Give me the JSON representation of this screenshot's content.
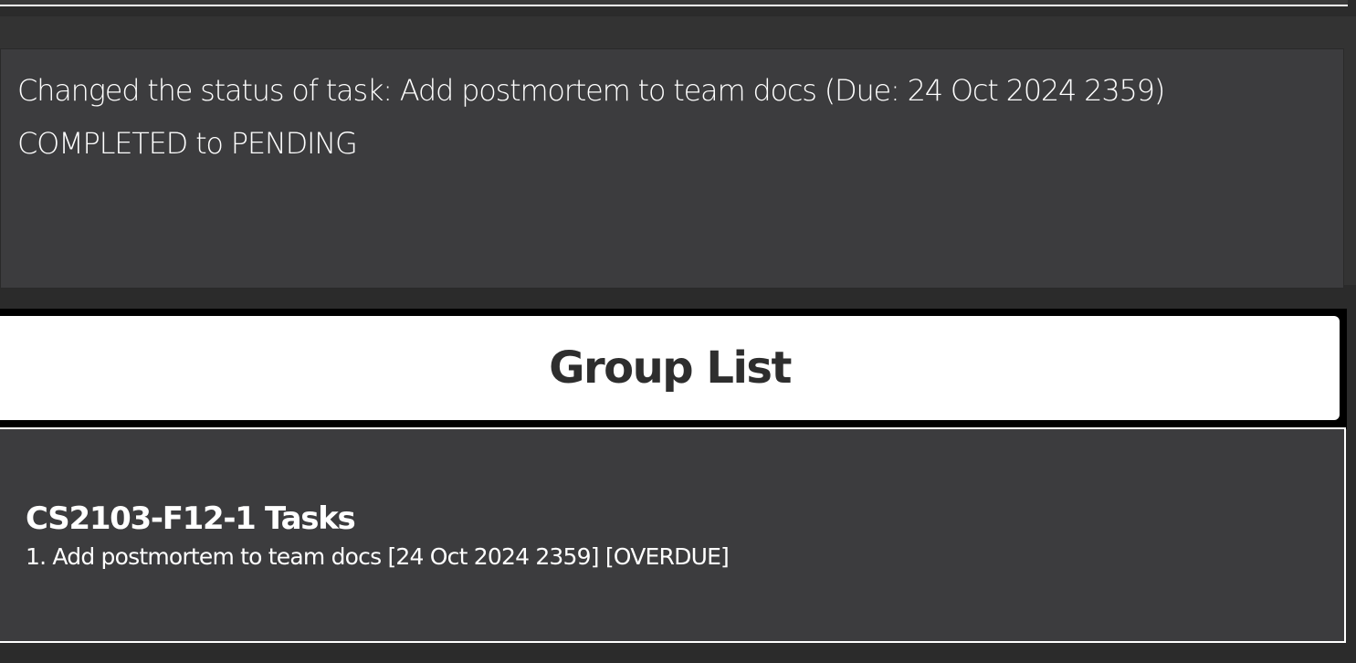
{
  "result": {
    "line1": "Changed the status of task: Add postmortem to team docs (Due: 24 Oct 2024 2359)",
    "line2": "COMPLETED to PENDING"
  },
  "group_list": {
    "title": "Group List",
    "groups": [
      {
        "name": "CS2103-F12-1 Tasks",
        "tasks": [
          "1. Add postmortem to team docs [24 Oct 2024 2359] [OVERDUE]"
        ]
      }
    ]
  }
}
